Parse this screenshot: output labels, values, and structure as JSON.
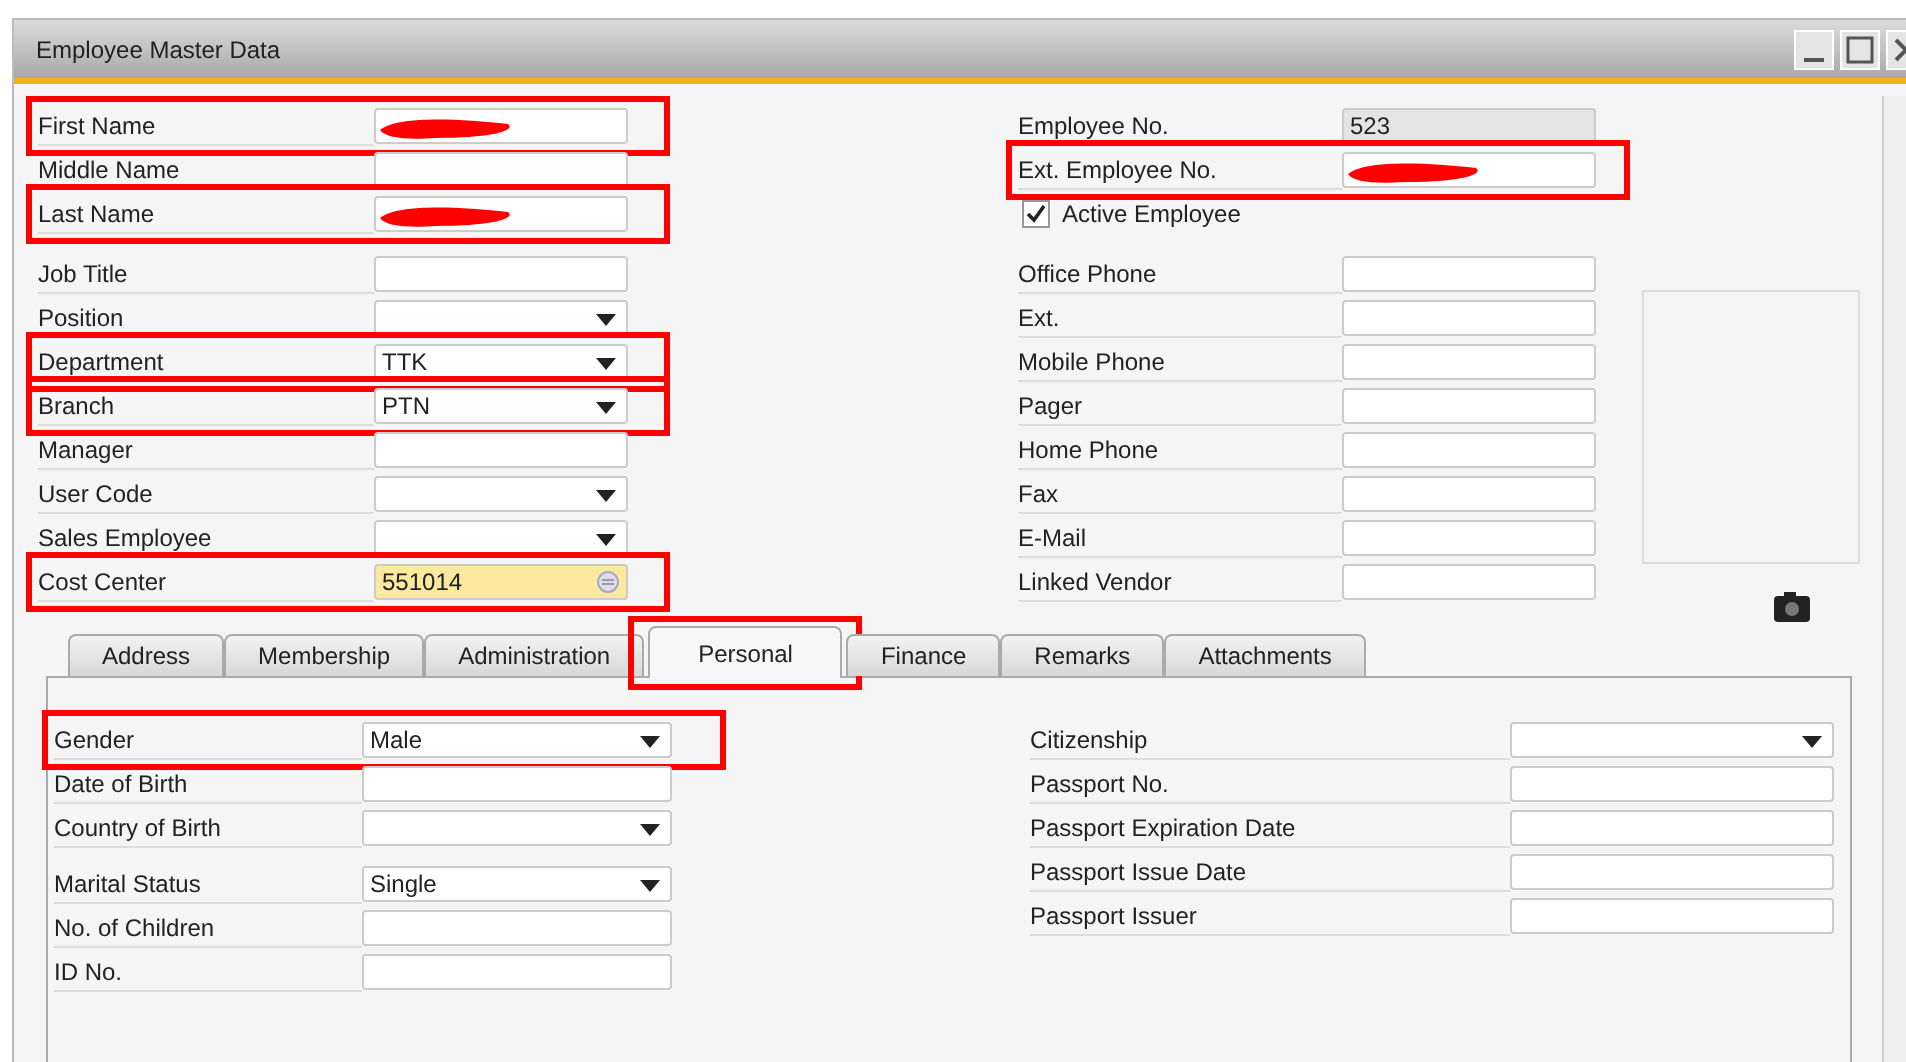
{
  "window": {
    "title": "Employee Master Data"
  },
  "left_groups": [
    [
      {
        "label": "First Name",
        "kind": "text",
        "redacted": true,
        "highlighted": true
      },
      {
        "label": "Middle Name",
        "kind": "text",
        "redacted": false,
        "highlighted": false
      },
      {
        "label": "Last Name",
        "kind": "text",
        "redacted": true,
        "highlighted": true
      }
    ],
    [
      {
        "label": "Job Title",
        "kind": "text",
        "redacted": false,
        "highlighted": false
      },
      {
        "label": "Position",
        "kind": "dropdown",
        "redacted": false,
        "highlighted": false
      },
      {
        "label": "Department",
        "kind": "dropdown",
        "value": "TTK",
        "redacted": false,
        "highlighted": true
      },
      {
        "label": "Branch",
        "kind": "dropdown",
        "value": "PTN",
        "redacted": false,
        "highlighted": true
      },
      {
        "label": "Manager",
        "kind": "text",
        "redacted": false,
        "highlighted": false
      },
      {
        "label": "User Code",
        "kind": "dropdown",
        "redacted": false,
        "highlighted": false
      },
      {
        "label": "Sales Employee",
        "kind": "dropdown",
        "redacted": false,
        "highlighted": false
      },
      {
        "label": "Cost Center",
        "kind": "lookup",
        "value": "551014",
        "redacted": false,
        "highlighted": true
      }
    ]
  ],
  "right_groups": [
    [
      {
        "label": "Employee No.",
        "kind": "readonly",
        "value": "523",
        "redacted": false,
        "highlighted": false
      },
      {
        "label": "Ext. Employee No.",
        "kind": "text",
        "redacted": true,
        "highlighted": true
      },
      {
        "label": "Active Employee",
        "kind": "checkbox",
        "checked": true
      }
    ],
    [
      {
        "label": "Office Phone",
        "kind": "text",
        "redacted": false,
        "highlighted": false
      },
      {
        "label": "Ext.",
        "kind": "text",
        "redacted": false,
        "highlighted": false
      },
      {
        "label": "Mobile Phone",
        "kind": "text",
        "redacted": false,
        "highlighted": false
      },
      {
        "label": "Pager",
        "kind": "text",
        "redacted": false,
        "highlighted": false
      },
      {
        "label": "Home Phone",
        "kind": "text",
        "redacted": false,
        "highlighted": false
      },
      {
        "label": "Fax",
        "kind": "text",
        "redacted": false,
        "highlighted": false
      },
      {
        "label": "E-Mail",
        "kind": "text",
        "redacted": false,
        "highlighted": false
      },
      {
        "label": "Linked Vendor",
        "kind": "text",
        "redacted": false,
        "highlighted": false
      }
    ]
  ],
  "tabs": [
    {
      "label": "Address",
      "selected": false,
      "highlighted": false
    },
    {
      "label": "Membership",
      "selected": false,
      "highlighted": false
    },
    {
      "label": "Administration",
      "selected": false,
      "highlighted": false
    },
    {
      "label": "Personal",
      "selected": true,
      "highlighted": true
    },
    {
      "label": "Finance",
      "selected": false,
      "highlighted": false
    },
    {
      "label": "Remarks",
      "selected": false,
      "highlighted": false
    },
    {
      "label": "Attachments",
      "selected": false,
      "highlighted": false
    }
  ],
  "personal_left_groups": [
    [
      {
        "label": "Gender",
        "kind": "dropdown",
        "value": "Male",
        "redacted": false,
        "highlighted": true
      },
      {
        "label": "Date of Birth",
        "kind": "text",
        "redacted": false,
        "highlighted": false
      },
      {
        "label": "Country of Birth",
        "kind": "dropdown",
        "redacted": false,
        "highlighted": false
      }
    ],
    [
      {
        "label": "Marital Status",
        "kind": "dropdown",
        "value": "Single",
        "redacted": false,
        "highlighted": false
      },
      {
        "label": "No. of Children",
        "kind": "text",
        "redacted": false,
        "highlighted": false
      },
      {
        "label": "ID No.",
        "kind": "text",
        "redacted": false,
        "highlighted": false
      }
    ]
  ],
  "personal_right_groups": [
    [
      {
        "label": "Citizenship",
        "kind": "dropdown",
        "redacted": false,
        "highlighted": false
      },
      {
        "label": "Passport No.",
        "kind": "text",
        "redacted": false,
        "highlighted": false
      },
      {
        "label": "Passport Expiration Date",
        "kind": "text",
        "redacted": false,
        "highlighted": false
      },
      {
        "label": "Passport Issue Date",
        "kind": "text",
        "redacted": false,
        "highlighted": false
      },
      {
        "label": "Passport Issuer",
        "kind": "text",
        "redacted": false,
        "highlighted": false
      }
    ]
  ]
}
